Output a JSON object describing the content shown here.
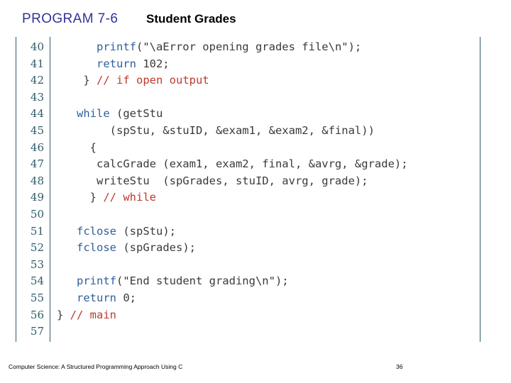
{
  "header": {
    "program_label": "PROGRAM 7-6",
    "program_subject": "Student Grades"
  },
  "colors": {
    "program_title": "#333399",
    "subtitle": "#000000",
    "rule": "#2e5c68",
    "line_number": "#2e5c68",
    "keyword": "#2f5f9e",
    "comment": "#c0392b",
    "plain": "#3a3a3a",
    "background": "#ffffff"
  },
  "code": {
    "first_line_number": 40,
    "last_line_number": 57,
    "lines": [
      {
        "number": "40",
        "tokens": [
          {
            "t": "kw",
            "s": "      printf"
          },
          {
            "t": "pl",
            "s": "(\"\\aError opening grades file\\n\");"
          }
        ]
      },
      {
        "number": "41",
        "tokens": [
          {
            "t": "kw",
            "s": "      return"
          },
          {
            "t": "pl",
            "s": " 102;"
          }
        ]
      },
      {
        "number": "42",
        "tokens": [
          {
            "t": "pl",
            "s": "    } "
          },
          {
            "t": "cm",
            "s": "// if open output"
          }
        ]
      },
      {
        "number": "43",
        "tokens": []
      },
      {
        "number": "44",
        "tokens": [
          {
            "t": "kw",
            "s": "   while"
          },
          {
            "t": "pl",
            "s": " (getStu"
          }
        ]
      },
      {
        "number": "45",
        "tokens": [
          {
            "t": "pl",
            "s": "        (spStu, &stuID, &exam1, &exam2, &final))"
          }
        ]
      },
      {
        "number": "46",
        "tokens": [
          {
            "t": "pl",
            "s": "     {"
          }
        ]
      },
      {
        "number": "47",
        "tokens": [
          {
            "t": "pl",
            "s": "      calcGrade (exam1, exam2, final, &avrg, &grade);"
          }
        ]
      },
      {
        "number": "48",
        "tokens": [
          {
            "t": "pl",
            "s": "      writeStu  (spGrades, stuID, avrg, grade);"
          }
        ]
      },
      {
        "number": "49",
        "tokens": [
          {
            "t": "pl",
            "s": "     } "
          },
          {
            "t": "cm",
            "s": "// while"
          }
        ]
      },
      {
        "number": "50",
        "tokens": []
      },
      {
        "number": "51",
        "tokens": [
          {
            "t": "kw",
            "s": "   fclose"
          },
          {
            "t": "pl",
            "s": " (spStu);"
          }
        ]
      },
      {
        "number": "52",
        "tokens": [
          {
            "t": "kw",
            "s": "   fclose"
          },
          {
            "t": "pl",
            "s": " (spGrades);"
          }
        ]
      },
      {
        "number": "53",
        "tokens": []
      },
      {
        "number": "54",
        "tokens": [
          {
            "t": "kw",
            "s": "   printf"
          },
          {
            "t": "pl",
            "s": "(\"End student grading\\n\");"
          }
        ]
      },
      {
        "number": "55",
        "tokens": [
          {
            "t": "kw",
            "s": "   return"
          },
          {
            "t": "pl",
            "s": " 0;"
          }
        ]
      },
      {
        "number": "56",
        "tokens": [
          {
            "t": "pl",
            "s": "} "
          },
          {
            "t": "cm",
            "s": "// main"
          }
        ]
      },
      {
        "number": "57",
        "tokens": []
      }
    ]
  },
  "footer": {
    "source": "Computer Science: A Structured Programming Approach Using C",
    "page_number": "36"
  }
}
